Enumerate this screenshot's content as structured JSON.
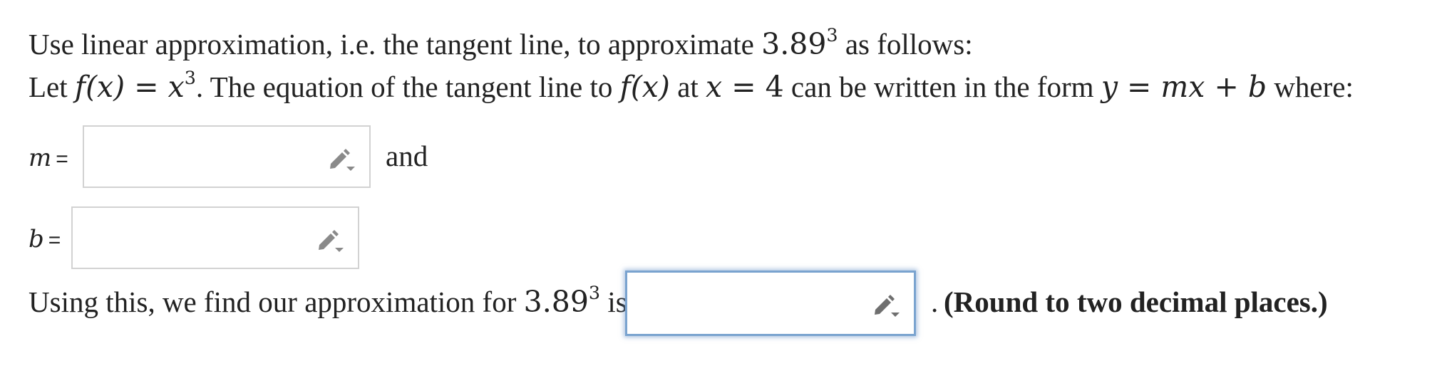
{
  "intro": {
    "prefix": "Use linear approximation, i.e. the tangent line, to approximate ",
    "base": "3.89",
    "exponent": "3",
    "suffix": " as follows:"
  },
  "setup": {
    "let": "Let ",
    "f_of_x": "f(x)",
    "equals": " = ",
    "x_var": "x",
    "exp": "3",
    "sentence": ". The equation of the tangent line to ",
    "at": " at ",
    "x_eq": "x",
    "eq4": " = 4",
    "can_be": " can be written in the form ",
    "form": "y = mx + b",
    "where": " where:"
  },
  "m_field": {
    "var": "m",
    "eq": "=",
    "value": "",
    "after": "and"
  },
  "b_field": {
    "var": "b",
    "eq": "=",
    "value": ""
  },
  "final": {
    "prefix": "Using this, we find our approximation for ",
    "base": "3.89",
    "exponent": "3",
    "is": " is",
    "value": "",
    "period": ".",
    "note": "(Round to two decimal places.)"
  },
  "icons": {
    "edit": "pencil-dropdown-icon"
  },
  "colors": {
    "focus_border": "#7aa3cf",
    "input_border": "#d2d2d2",
    "icon": "#8a8a8a"
  }
}
